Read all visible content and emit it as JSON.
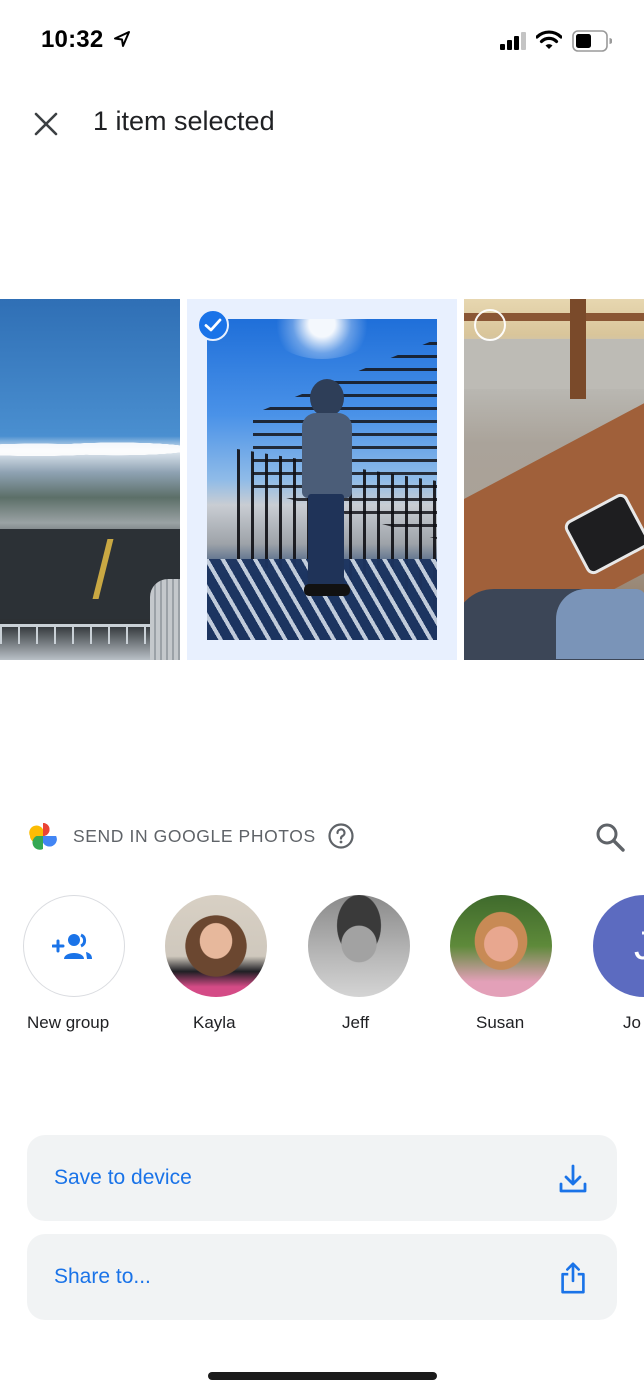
{
  "status_bar": {
    "time": "10:32",
    "icons": [
      "location-arrow-icon",
      "cellular-signal-icon",
      "wifi-icon",
      "battery-icon"
    ]
  },
  "app_bar": {
    "close_icon": "close-icon",
    "title": "1 item selected"
  },
  "photos": [
    {
      "description": "Airport runway with mountains",
      "selected": false,
      "partially_visible": true
    },
    {
      "description": "Child standing at railing on balcony",
      "selected": true
    },
    {
      "description": "Child holding phone at table",
      "selected": false,
      "partially_visible": true
    }
  ],
  "send_section": {
    "label": "SEND IN GOOGLE PHOTOS",
    "help_icon": "help-circle-icon",
    "search_icon": "search-icon",
    "contacts": [
      {
        "name": "New group",
        "type": "new-group"
      },
      {
        "name": "Kayla"
      },
      {
        "name": "Jeff"
      },
      {
        "name": "Susan"
      },
      {
        "name": "Jo",
        "initial": "J"
      }
    ]
  },
  "actions": {
    "save": {
      "label": "Save to device",
      "icon": "download-icon"
    },
    "share": {
      "label": "Share to...",
      "icon": "share-icon"
    }
  },
  "colors": {
    "accent": "#1a73e8",
    "selected_frame": "#e8f0fe",
    "action_bg": "#f1f3f4",
    "secondary_text": "#5f6368",
    "avatar_j": "#5c6bc0"
  }
}
